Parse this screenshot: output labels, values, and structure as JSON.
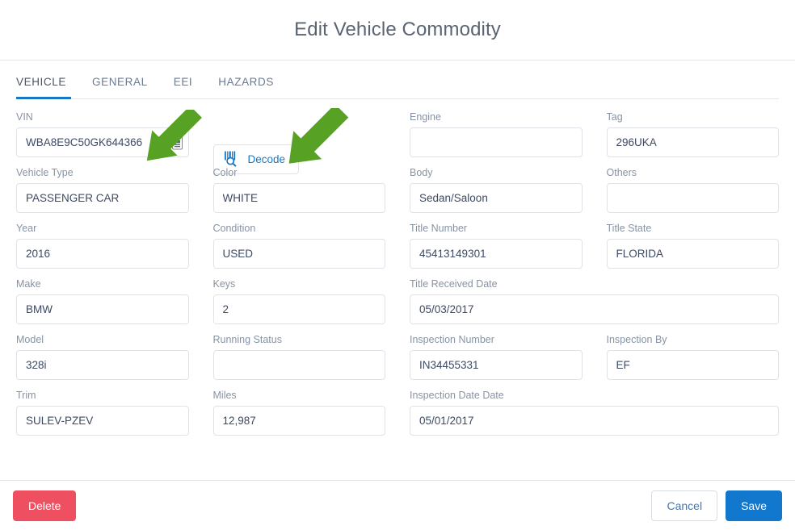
{
  "header": {
    "title": "Edit Vehicle Commodity"
  },
  "tabs": [
    {
      "label": "VEHICLE",
      "active": true
    },
    {
      "label": "GENERAL",
      "active": false
    },
    {
      "label": "EEI",
      "active": false
    },
    {
      "label": "HAZARDS",
      "active": false
    }
  ],
  "form": {
    "vin": {
      "label": "VIN",
      "value": "WBA8E9C50GK644366",
      "placeholder": "",
      "icon": "barcode-scan-icon"
    },
    "decode": {
      "label": "Decode",
      "icon": "barcode-search-icon"
    },
    "engine": {
      "label": "Engine",
      "value": "",
      "placeholder": ""
    },
    "tag": {
      "label": "Tag",
      "value": "296UKA",
      "placeholder": ""
    },
    "vehicle_type": {
      "label": "Vehicle Type",
      "value": "PASSENGER CAR",
      "placeholder": ""
    },
    "color": {
      "label": "Color",
      "value": "WHITE",
      "placeholder": ""
    },
    "body": {
      "label": "Body",
      "value": "Sedan/Saloon",
      "placeholder": ""
    },
    "others": {
      "label": "Others",
      "value": "",
      "placeholder": ""
    },
    "year": {
      "label": "Year",
      "value": "2016",
      "placeholder": ""
    },
    "condition": {
      "label": "Condition",
      "value": "USED",
      "placeholder": ""
    },
    "title_number": {
      "label": "Title Number",
      "value": "45413149301",
      "placeholder": ""
    },
    "title_state": {
      "label": "Title State",
      "value": "FLORIDA",
      "placeholder": ""
    },
    "make": {
      "label": "Make",
      "value": "BMW",
      "placeholder": ""
    },
    "keys": {
      "label": "Keys",
      "value": "2",
      "placeholder": ""
    },
    "title_received_date": {
      "label": "Title Received Date",
      "value": "05/03/2017",
      "placeholder": ""
    },
    "model": {
      "label": "Model",
      "value": "328i",
      "placeholder": ""
    },
    "running_status": {
      "label": "Running Status",
      "value": "",
      "placeholder": ""
    },
    "inspection_number": {
      "label": "Inspection Number",
      "value": "IN34455331",
      "placeholder": ""
    },
    "inspection_by": {
      "label": "Inspection By",
      "value": "EF",
      "placeholder": ""
    },
    "trim": {
      "label": "Trim",
      "value": "SULEV-PZEV",
      "placeholder": ""
    },
    "miles": {
      "label": "Miles",
      "value": "12,987",
      "placeholder": ""
    },
    "inspection_date_date": {
      "label": "Inspection Date Date",
      "value": "05/01/2017",
      "placeholder": ""
    }
  },
  "footer": {
    "delete_label": "Delete",
    "cancel_label": "Cancel",
    "save_label": "Save"
  },
  "annotations": [
    {
      "name": "arrow-pointing-to-vin-scan-icon",
      "color": "#57a game"
    },
    {
      "name": "arrow-pointing-to-decode-button"
    }
  ],
  "colors": {
    "accent_blue": "#1778c6",
    "danger_red": "#ef5061",
    "save_blue": "#1178cd",
    "annotation_green": "#57a224",
    "label_gray": "#8793a4",
    "border_gray": "#dfe3e8"
  }
}
